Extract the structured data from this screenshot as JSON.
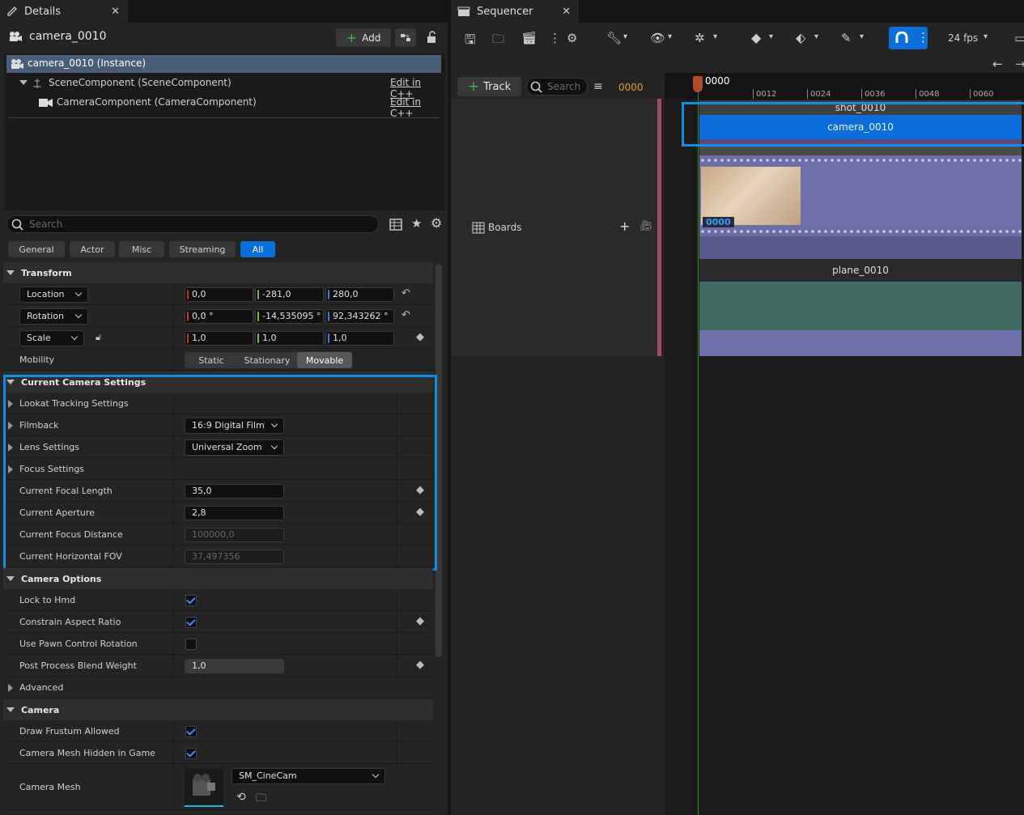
{
  "details": {
    "tab_title": "Details",
    "actor_name": "camera_0010",
    "add_label": "Add",
    "components": [
      {
        "label": "camera_0010 (Instance)"
      },
      {
        "label": "SceneComponent (SceneComponent)",
        "edit": "Edit in C++"
      },
      {
        "label": "CameraComponent (CameraComponent)",
        "edit": "Edit in C++"
      }
    ],
    "search_placeholder": "Search",
    "filter_tabs": [
      "General",
      "Actor",
      "Misc",
      "Streaming",
      "All"
    ],
    "active_filter": "All",
    "transform": {
      "title": "Transform",
      "location": {
        "label": "Location",
        "x": "0,0",
        "y": "-281,0",
        "z": "280,0"
      },
      "rotation": {
        "label": "Rotation",
        "x": "0,0 °",
        "y": "-14,535095 °",
        "z": "92,343262 °"
      },
      "scale": {
        "label": "Scale",
        "x": "1,0",
        "y": "1,0",
        "z": "1,0"
      },
      "mobility": {
        "label": "Mobility",
        "options": [
          "Static",
          "Stationary",
          "Movable"
        ],
        "selected": "Movable"
      }
    },
    "camera_settings": {
      "title": "Current Camera Settings",
      "lookat": "Lookat Tracking Settings",
      "filmback": {
        "label": "Filmback",
        "value": "16:9 Digital Film"
      },
      "lens": {
        "label": "Lens Settings",
        "value": "Universal Zoom"
      },
      "focus": "Focus Settings",
      "focal_length": {
        "label": "Current Focal Length",
        "value": "35,0"
      },
      "aperture": {
        "label": "Current Aperture",
        "value": "2,8"
      },
      "focus_distance": {
        "label": "Current Focus Distance",
        "value": "100000,0"
      },
      "hfov": {
        "label": "Current Horizontal FOV",
        "value": "37,497356"
      }
    },
    "camera_options": {
      "title": "Camera Options",
      "lock_hmd": {
        "label": "Lock to Hmd",
        "checked": true
      },
      "constrain": {
        "label": "Constrain Aspect Ratio",
        "checked": true
      },
      "pawn_rot": {
        "label": "Use Pawn Control Rotation",
        "checked": false
      },
      "pp_blend": {
        "label": "Post Process Blend Weight",
        "value": "1,0"
      },
      "advanced": "Advanced"
    },
    "camera": {
      "title": "Camera",
      "frustum": {
        "label": "Draw Frustum Allowed",
        "checked": true
      },
      "mesh_hidden": {
        "label": "Camera Mesh Hidden in Game",
        "checked": true
      },
      "mesh": {
        "label": "Camera Mesh",
        "value": "SM_CineCam"
      }
    }
  },
  "sequencer": {
    "tab_title": "Sequencer",
    "fps": "24 fps",
    "track_label": "Track",
    "search_placeholder": "Search",
    "frame": "0000",
    "playhead_frame": "0000",
    "ticks": [
      "0012",
      "0024",
      "0036",
      "0048",
      "0060"
    ],
    "boards_label": "Boards",
    "shot_label": "shot_0010",
    "camera_section": "camera_0010",
    "thumb_frame": "0000",
    "plane_label": "plane_0010"
  },
  "colors": {
    "accent": "#0a6fdb",
    "highlight": "#0b8fe0",
    "film": "#6e6ea8",
    "teal": "#3f6b62"
  }
}
